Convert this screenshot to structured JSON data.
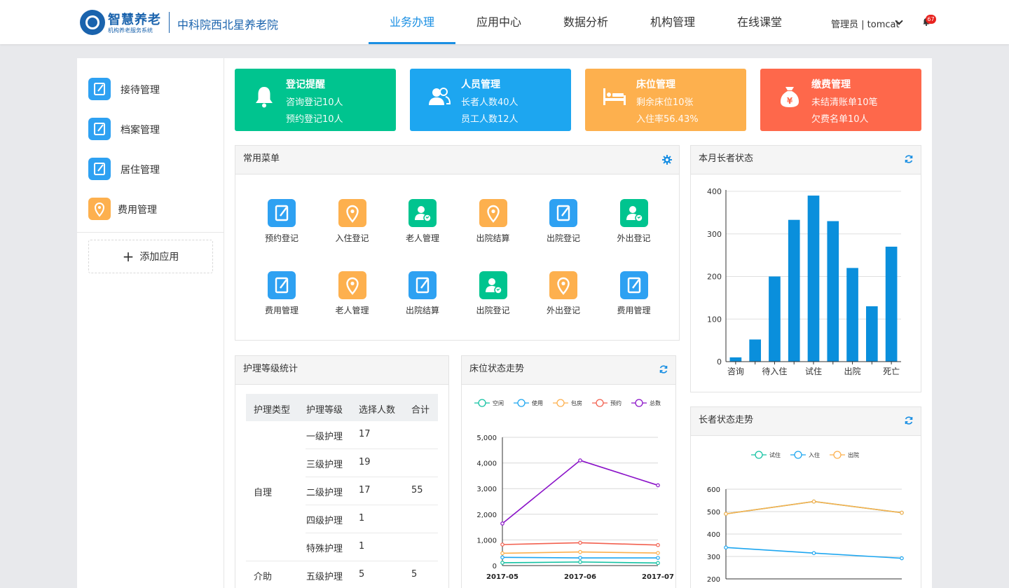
{
  "header": {
    "logo_title": "智慧养老",
    "logo_subtitle": "机构养老服务系统",
    "org_name": "中科院西北星养老院",
    "tabs": [
      {
        "label": "业务办理",
        "active": true
      },
      {
        "label": "应用中心",
        "active": false
      },
      {
        "label": "数据分析",
        "active": false
      },
      {
        "label": "机构管理",
        "active": false
      },
      {
        "label": "在线课堂",
        "active": false
      }
    ],
    "user": "管理员 | tomcat",
    "notifications": "67"
  },
  "sidebar": {
    "items": [
      {
        "label": "接待管理",
        "icon": "document-icon",
        "color": "#2ea1f2"
      },
      {
        "label": "档案管理",
        "icon": "document-icon",
        "color": "#2ea1f2"
      },
      {
        "label": "居住管理",
        "icon": "document-icon",
        "color": "#2ea1f2"
      },
      {
        "label": "费用管理",
        "icon": "location-pin-icon",
        "color": "#fdb04e"
      }
    ],
    "add_app": "添加应用"
  },
  "cards": [
    {
      "title": "登记提醒",
      "lines": [
        "咨询登记10人",
        "预约登记10人"
      ],
      "color": "#00c48f",
      "icon": "bell-icon"
    },
    {
      "title": "人员管理",
      "lines": [
        "长者人数40人",
        "员工人数12人"
      ],
      "color": "#1da6f0",
      "icon": "people-icon"
    },
    {
      "title": "床位管理",
      "lines": [
        "剩余床位10张",
        "入住率56.43%"
      ],
      "color": "#fdb04e",
      "icon": "bed-icon"
    },
    {
      "title": "缴费管理",
      "lines": [
        "未结清账单10笔",
        "欠费名单10人"
      ],
      "color": "#fe684b",
      "icon": "money-bag-icon"
    }
  ],
  "common_menu": {
    "title": "常用菜单",
    "items": [
      {
        "label": "预约登记",
        "icon": "document-icon",
        "color": "#2ea1f2"
      },
      {
        "label": "入住登记",
        "icon": "location-pin-icon",
        "color": "#fdb04e"
      },
      {
        "label": "老人管理",
        "icon": "user-phone-icon",
        "color": "#00c48f"
      },
      {
        "label": "出院结算",
        "icon": "location-pin-icon",
        "color": "#fdb04e"
      },
      {
        "label": "出院登记",
        "icon": "document-icon",
        "color": "#2ea1f2"
      },
      {
        "label": "外出登记",
        "icon": "user-phone-icon",
        "color": "#00c48f"
      },
      {
        "label": "费用管理",
        "icon": "document-icon",
        "color": "#2ea1f2"
      },
      {
        "label": "老人管理",
        "icon": "location-pin-icon",
        "color": "#fdb04e"
      },
      {
        "label": "出院结算",
        "icon": "document-icon",
        "color": "#2ea1f2"
      },
      {
        "label": "出院登记",
        "icon": "user-phone-icon",
        "color": "#00c48f"
      },
      {
        "label": "外出登记",
        "icon": "location-pin-icon",
        "color": "#fdb04e"
      },
      {
        "label": "费用管理",
        "icon": "document-icon",
        "color": "#2ea1f2"
      }
    ]
  },
  "care_table": {
    "title": "护理等级统计",
    "columns": [
      "护理类型",
      "护理等级",
      "选择人数",
      "合计"
    ],
    "rows": [
      {
        "level": "一级护理",
        "count": "17"
      },
      {
        "level": "三级护理",
        "count": "19"
      },
      {
        "level": "二级护理",
        "count": "17"
      },
      {
        "level": "四级护理",
        "count": "1"
      },
      {
        "level": "特殊护理",
        "count": "1"
      },
      {
        "level": "五级护理",
        "count": "5"
      }
    ],
    "groups": [
      {
        "type": "自理",
        "total": "55"
      },
      {
        "type": "介助",
        "total": "5"
      }
    ]
  },
  "elder_status": {
    "title": "本月长者状态",
    "chart_data": {
      "type": "bar",
      "title": "",
      "categories": [
        "咨询",
        "",
        "待入住",
        "",
        "试住",
        "",
        "出院",
        "",
        "死亡"
      ],
      "values": [
        10,
        52,
        200,
        333,
        390,
        330,
        220,
        130,
        270
      ],
      "ylim": [
        0,
        400
      ],
      "yticks": [
        0,
        100,
        200,
        300,
        400
      ],
      "color": "#0a8fdc"
    }
  },
  "bed_trend": {
    "title": "床位状态走势",
    "chart_data": {
      "type": "line",
      "title": "",
      "x": [
        "2017-05",
        "2017-06",
        "2017-07"
      ],
      "ylim": [
        0,
        5000
      ],
      "yticks": [
        "0",
        "1,000",
        "2,000",
        "3,000",
        "4,000",
        "5,000"
      ],
      "series": [
        {
          "name": "空闲",
          "values": [
            110,
            140,
            100
          ],
          "color": "#13c2a3"
        },
        {
          "name": "使用",
          "values": [
            320,
            300,
            300
          ],
          "color": "#1da6f0"
        },
        {
          "name": "包房",
          "values": [
            480,
            530,
            490
          ],
          "color": "#fdb04e"
        },
        {
          "name": "预约",
          "values": [
            820,
            890,
            800
          ],
          "color": "#f2604f"
        },
        {
          "name": "总数",
          "values": [
            1640,
            4100,
            3130
          ],
          "color": "#8a12c8"
        }
      ]
    }
  },
  "elder_trend": {
    "title": "长者状态走势",
    "chart_data": {
      "type": "line",
      "title": "",
      "ylim": [
        200,
        600
      ],
      "yticks": [
        200,
        300,
        400,
        500,
        600
      ],
      "series": [
        {
          "name": "试住",
          "values": [
            490,
            545,
            495
          ],
          "color": "#13c2a3"
        },
        {
          "name": "入住",
          "values": [
            340,
            315,
            292
          ],
          "color": "#1da6f0"
        },
        {
          "name": "出院",
          "values": [
            490,
            545,
            495
          ],
          "color": "#fdb04e"
        }
      ]
    }
  }
}
